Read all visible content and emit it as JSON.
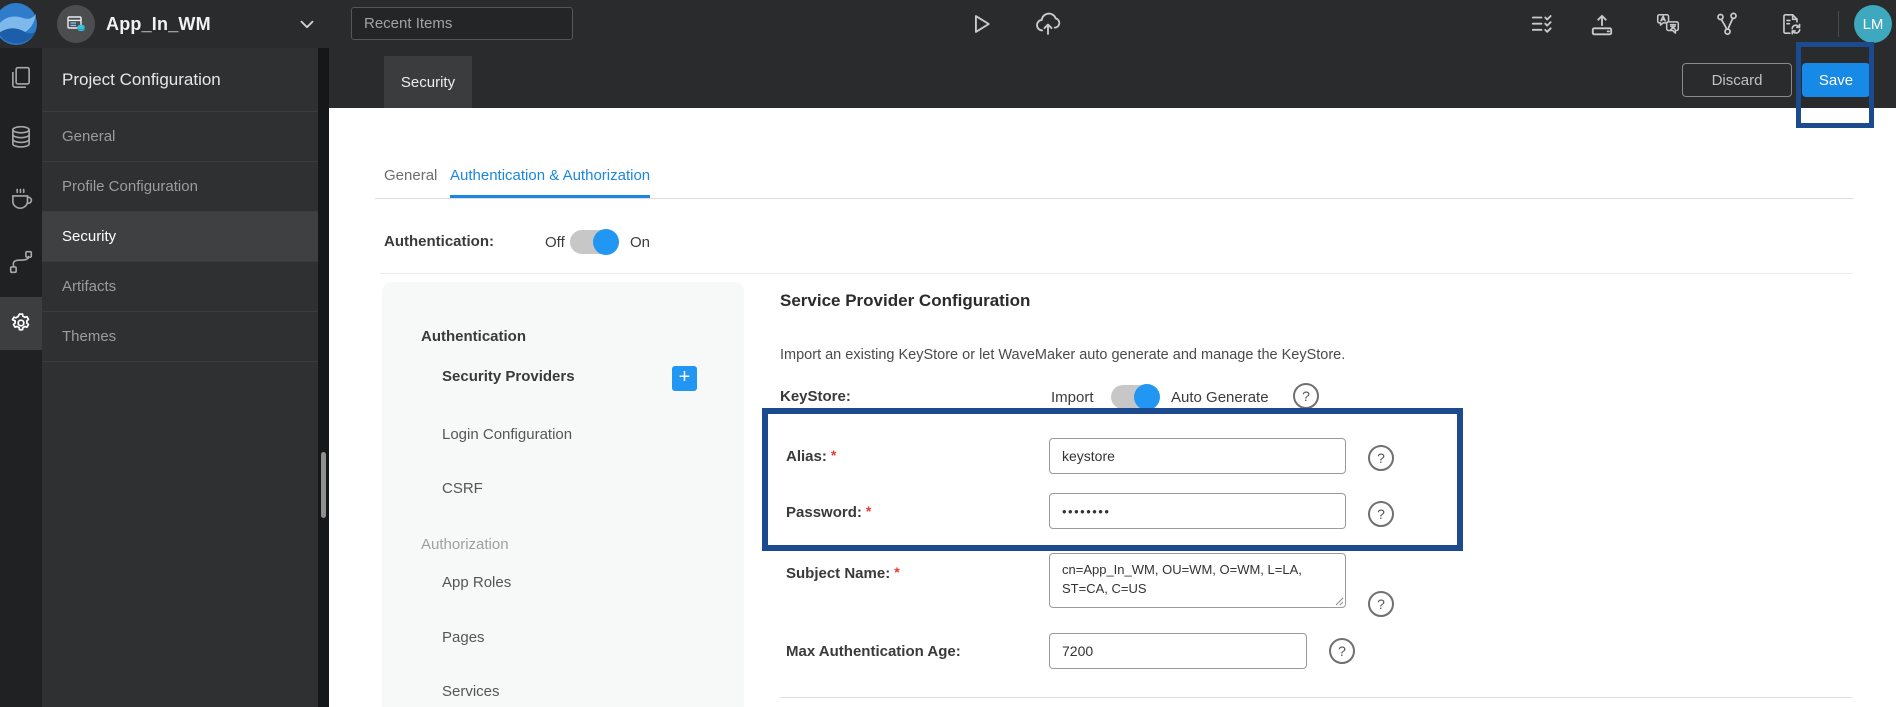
{
  "topbar": {
    "app_name": "App_In_WM",
    "recent_items_placeholder": "Recent Items",
    "avatar_initials": "LM"
  },
  "header": {
    "active_doc_tab": "Security",
    "discard_label": "Discard",
    "save_label": "Save"
  },
  "sidebar": {
    "title": "Project Configuration",
    "items": [
      {
        "label": "General"
      },
      {
        "label": "Profile Configuration"
      },
      {
        "label": "Security",
        "selected": true
      },
      {
        "label": "Artifacts"
      },
      {
        "label": "Themes"
      }
    ]
  },
  "tabs": {
    "items": [
      {
        "label": "General",
        "active": false
      },
      {
        "label": "Authentication & Authorization",
        "active": true
      }
    ]
  },
  "authentication_toggle": {
    "label": "Authentication:",
    "off_label": "Off",
    "on_label": "On",
    "state": "on"
  },
  "subnav": {
    "sections": [
      {
        "title": "Authentication",
        "items": [
          {
            "label": "Security Providers",
            "has_add_button": true
          },
          {
            "label": "Login Configuration"
          },
          {
            "label": "CSRF"
          }
        ]
      },
      {
        "title": "Authorization",
        "items": [
          {
            "label": "App Roles"
          },
          {
            "label": "Pages"
          },
          {
            "label": "Services"
          }
        ]
      }
    ],
    "add_button_glyph": "+"
  },
  "service_provider": {
    "title": "Service Provider Configuration",
    "description": "Import an existing KeyStore or let WaveMaker auto generate and manage the KeyStore.",
    "keystore": {
      "label": "KeyStore:",
      "left_option": "Import",
      "right_option": "Auto Generate",
      "selected": "Auto Generate"
    },
    "fields": {
      "alias": {
        "label": "Alias:",
        "required": "*",
        "value": "keystore"
      },
      "password": {
        "label": "Password:",
        "required": "*",
        "value": "••••••••"
      },
      "subject_name": {
        "label": "Subject Name:",
        "required": "*",
        "value": "cn=App_In_WM, OU=WM, O=WM, L=LA,\nST=CA, C=US"
      },
      "max_auth_age": {
        "label": "Max Authentication Age:",
        "value": "7200"
      }
    }
  },
  "ui": {
    "help_glyph": "?"
  },
  "colors": {
    "accent_blue": "#1b87e0",
    "save_button_blue": "#1789e6",
    "annotation_blue": "#1c4a8f",
    "toggle_knob_blue": "#2196f3",
    "required_red": "#e53935",
    "avatar_teal": "#3ea8be"
  }
}
